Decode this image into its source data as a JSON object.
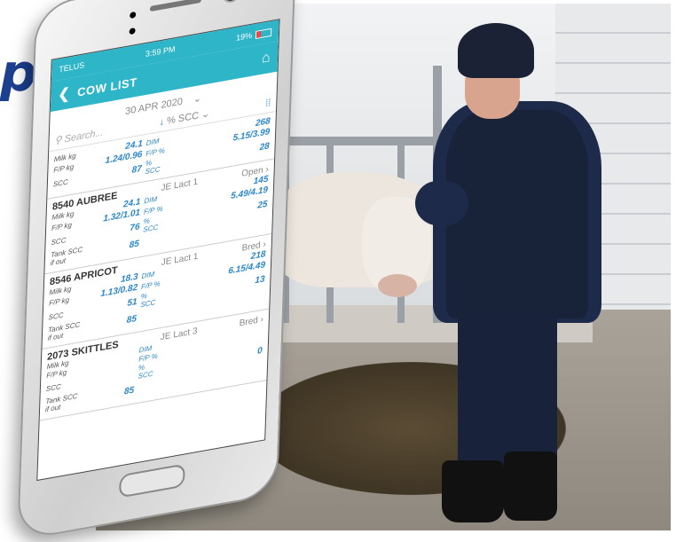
{
  "headline": "pp",
  "app": {
    "status": {
      "carrier": "TELUS",
      "time": "3:59 PM",
      "battery": "19%"
    },
    "title": "COW LIST",
    "date": "30 APR 2020",
    "sort_label": "% SCC",
    "search_placeholder": "Search...",
    "partial_top": {
      "milk": "24.1",
      "fp_kg": "1.24/0.96",
      "scc": "87",
      "dim": "268",
      "fp_pct": "5.15/3.99",
      "pct_scc": "28"
    },
    "labels": {
      "milk_kg": "Milk kg",
      "fp_kg": "F/P kg",
      "scc": "SCC",
      "tank": "Tank SCC if out",
      "dim": "DIM",
      "fp_pct": "F/P %",
      "pct_scc": "% SCC"
    },
    "cows": [
      {
        "name": "8540 AUBREE",
        "breed_lact": "JE Lact 1",
        "status": "Open",
        "milk": "24.1",
        "fp_kg": "1.32/1.01",
        "scc": "76",
        "tank": "85",
        "dim": "145",
        "fp_pct": "5.49/4.19",
        "pct_scc": "25"
      },
      {
        "name": "8546 APRICOT",
        "breed_lact": "JE Lact 1",
        "status": "Bred",
        "milk": "18.3",
        "fp_kg": "1.13/0.82",
        "scc": "51",
        "tank": "85",
        "dim": "218",
        "fp_pct": "6.15/4.49",
        "pct_scc": "13"
      },
      {
        "name": "2073 SKITTLES",
        "breed_lact": "JE Lact 3",
        "status": "Bred",
        "milk": "",
        "fp_kg": "",
        "scc": "",
        "tank": "85",
        "dim": "",
        "fp_pct": "",
        "pct_scc": "0"
      }
    ]
  }
}
